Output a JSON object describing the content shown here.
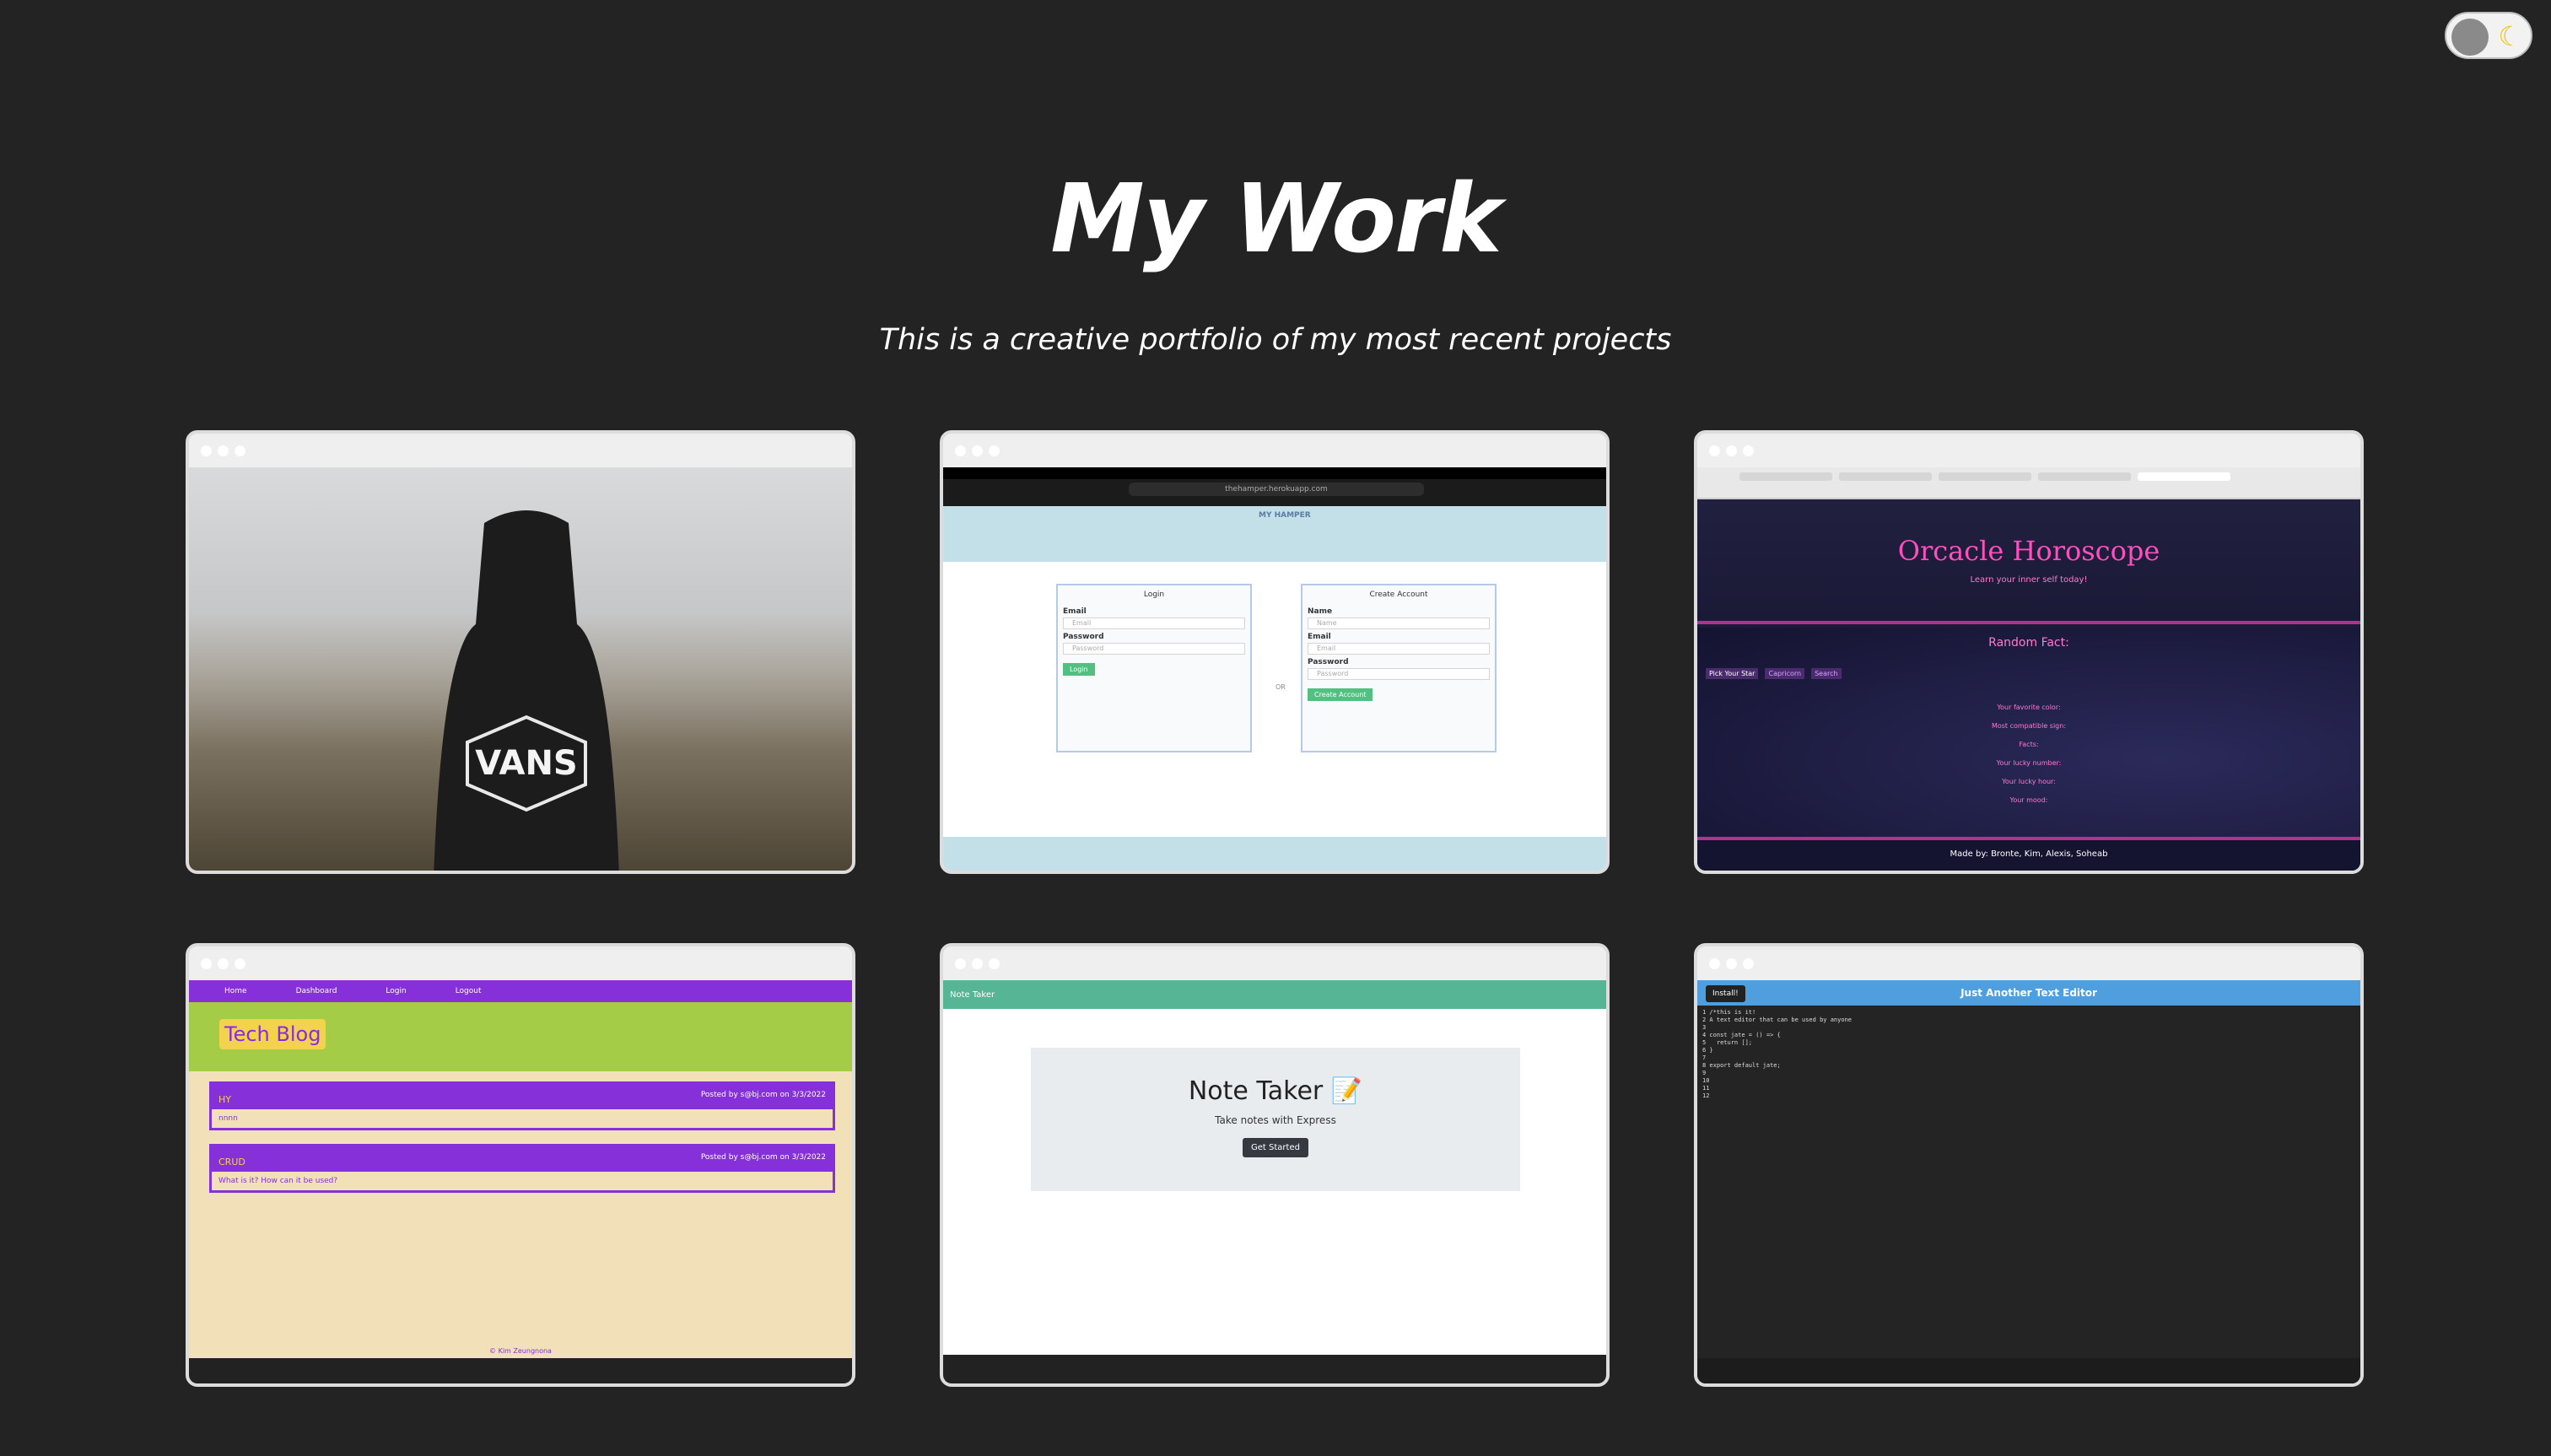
{
  "header": {
    "title": "My Work",
    "subtitle": "This is a creative portfolio of my most recent projects"
  },
  "theme_toggle": {
    "icon": "moon-icon",
    "state": "dark"
  },
  "colors": {
    "background": "#232323",
    "text": "#ffffff"
  },
  "projects": [
    {
      "name": "vans-hoodie-photo",
      "brand_text": "VANS"
    },
    {
      "name": "my-hamper",
      "url": "thehamper.herokuapp.com",
      "logo": "MY HAMPER",
      "login": {
        "title": "Login",
        "email_label": "Email",
        "email_placeholder": "Email",
        "password_label": "Password",
        "password_placeholder": "Password",
        "button": "Login"
      },
      "or": "OR",
      "create": {
        "title": "Create Account",
        "name_label": "Name",
        "name_placeholder": "Name",
        "email_label": "Email",
        "email_placeholder": "Email",
        "password_label": "Password",
        "password_placeholder": "Password",
        "button": "Create Account"
      }
    },
    {
      "name": "oracle-horoscope",
      "title": "Orcacle Horoscope",
      "tagline": "Learn your inner self today!",
      "random_fact": "Random Fact:",
      "chips": [
        "Pick Your Star",
        "Capricorn",
        "Search"
      ],
      "lines": [
        "Your favorite color:",
        "Most compatible sign:",
        "Facts:",
        "Your lucky number:",
        "Your lucky hour:",
        "Your mood:"
      ],
      "footer": "Made by: Bronte, Kim, Alexis, Soheab"
    },
    {
      "name": "tech-blog",
      "nav": [
        "Home",
        "Dashboard",
        "Login",
        "Logout"
      ],
      "title": "Tech Blog",
      "posts": [
        {
          "title": "HY",
          "meta": "Posted by s@bj.com on 3/3/2022",
          "body": "nnnn"
        },
        {
          "title": "CRUD",
          "meta": "Posted by s@bj.com on 3/3/2022",
          "body": "What is it? How can it be used?"
        }
      ],
      "copyright": "© Kim Zeungnona"
    },
    {
      "name": "note-taker",
      "nav_title": "Note Taker",
      "title": "Note Taker 📝",
      "subtitle": "Take notes with Express",
      "button": "Get Started"
    },
    {
      "name": "text-editor",
      "install": "Install!",
      "title": "Just Another Text Editor",
      "code": "1 /*this is it!\n2 A text editor that can be used by anyone\n3\n4 const jate = () => {\n5   return [];\n6 }\n7\n8 export default jate;\n9\n10\n11\n12"
    }
  ]
}
